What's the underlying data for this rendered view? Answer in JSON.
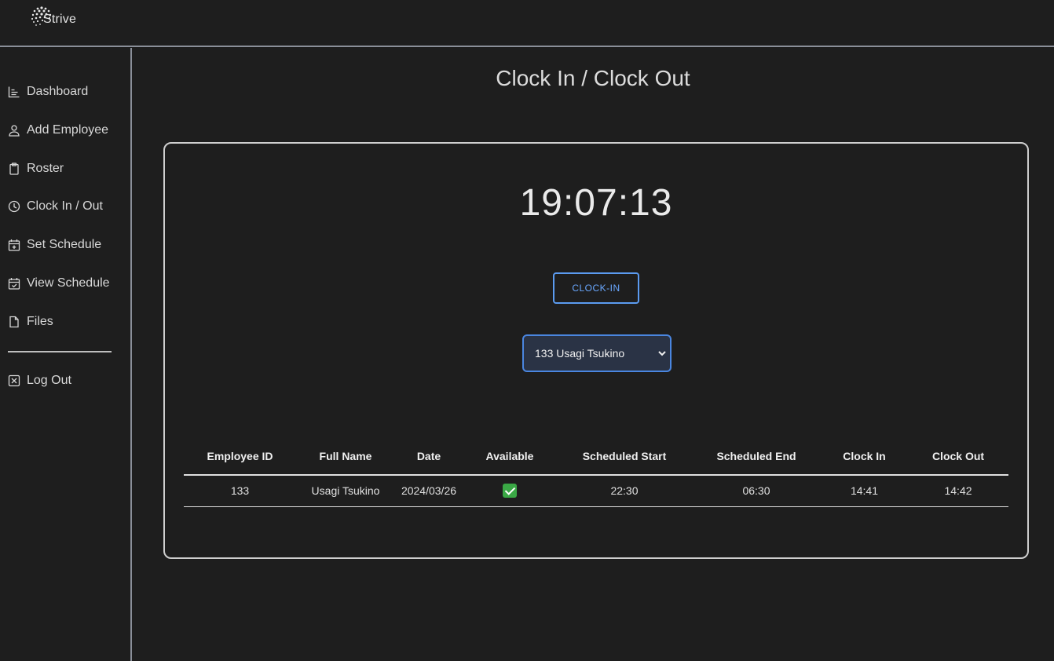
{
  "app": {
    "brand": "Strive"
  },
  "sidebar": {
    "items": [
      {
        "label": "Dashboard",
        "icon": "chart-icon"
      },
      {
        "label": "Add Employee",
        "icon": "person-icon"
      },
      {
        "label": "Roster",
        "icon": "clipboard-icon"
      },
      {
        "label": "Clock In / Out",
        "icon": "clock-icon"
      },
      {
        "label": "Set Schedule",
        "icon": "calendar-plus-icon"
      },
      {
        "label": "View Schedule",
        "icon": "calendar-check-icon"
      },
      {
        "label": "Files",
        "icon": "file-icon"
      }
    ],
    "logout": {
      "label": "Log Out",
      "icon": "x-square-icon"
    }
  },
  "page": {
    "title": "Clock In / Clock Out"
  },
  "panel": {
    "clock_time": "19:07:13",
    "clockin_button": "CLOCK-IN",
    "employee_select": {
      "selected": "133 Usagi Tsukino"
    },
    "table": {
      "headers": [
        "Employee ID",
        "Full Name",
        "Date",
        "Available",
        "Scheduled Start",
        "Scheduled End",
        "Clock In",
        "Clock Out"
      ],
      "rows": [
        {
          "employee_id": "133",
          "full_name": "Usagi Tsukino",
          "date": "2024/03/26",
          "available": "check-icon",
          "scheduled_start": "22:30",
          "scheduled_end": "06:30",
          "clock_in": "14:41",
          "clock_out": "14:42"
        }
      ]
    }
  },
  "colors": {
    "background": "#1e1e1e",
    "accent": "#5b9bf0",
    "available": "#3aa845"
  }
}
